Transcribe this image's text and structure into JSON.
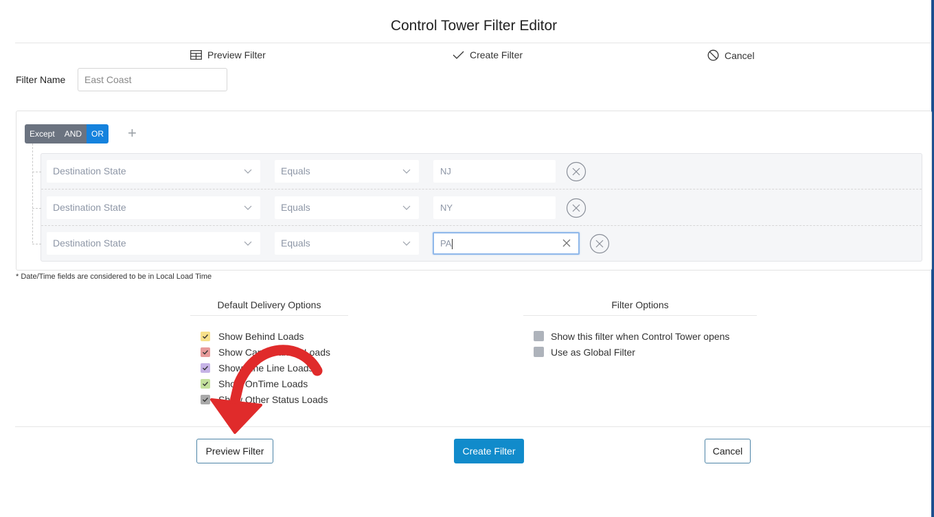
{
  "dialog": {
    "title": "Control Tower Filter Editor"
  },
  "top_actions": {
    "preview": "Preview Filter",
    "create": "Create Filter",
    "cancel": "Cancel"
  },
  "filter_name": {
    "label": "Filter Name",
    "value": "East Coast"
  },
  "logic": {
    "except": "Except",
    "and": "AND",
    "or": "OR",
    "active": "OR",
    "add_symbol": "+"
  },
  "rules": [
    {
      "field": "Destination State",
      "operator": "Equals",
      "value": "NJ"
    },
    {
      "field": "Destination State",
      "operator": "Equals",
      "value": "NY"
    },
    {
      "field": "Destination State",
      "operator": "Equals",
      "value": "PA"
    }
  ],
  "note": "* Date/Time fields are considered to be in Local Load Time",
  "delivery_options": {
    "title": "Default Delivery Options",
    "items": [
      {
        "label": "Show Behind Loads",
        "color": "#f7e08a",
        "checked": true
      },
      {
        "label": "Show Can't Make It Loads",
        "color": "#e79a9a",
        "checked": true
      },
      {
        "label": "Show Fine Line Loads",
        "color": "#c6b3e6",
        "checked": true
      },
      {
        "label": "Show OnTime Loads",
        "color": "#c3e09c",
        "checked": true
      },
      {
        "label": "Show Other Status Loads",
        "color": "#a9a9a9",
        "checked": true
      }
    ]
  },
  "filter_options": {
    "title": "Filter Options",
    "items": [
      {
        "label": "Show this filter when Control Tower opens",
        "checked": false
      },
      {
        "label": "Use as Global Filter",
        "checked": false
      }
    ]
  },
  "footer": {
    "preview": "Preview Filter",
    "create": "Create Filter",
    "cancel": "Cancel"
  },
  "colors": {
    "primary": "#118bcb",
    "logic_active": "#1582dd",
    "logic_inactive": "#6b7380",
    "annotation_arrow": "#e02b2b"
  }
}
